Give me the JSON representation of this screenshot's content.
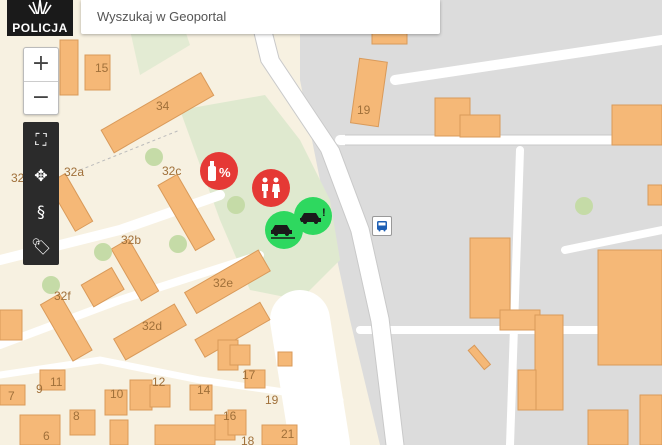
{
  "logo": {
    "text": "POLICJA"
  },
  "search": {
    "placeholder": "Wyszukaj w Geoportal"
  },
  "zoom": {
    "in": "+",
    "out": "−"
  },
  "tools": [
    "⛶",
    "✥",
    "§",
    "🏷"
  ],
  "labels": [
    {
      "t": "15"
    },
    {
      "t": "34"
    },
    {
      "t": "19"
    },
    {
      "t": "32a"
    },
    {
      "t": "32"
    },
    {
      "t": "32c"
    },
    {
      "t": "32b"
    },
    {
      "t": "32f"
    },
    {
      "t": "32e"
    },
    {
      "t": "32d"
    },
    {
      "t": "9"
    },
    {
      "t": "11"
    },
    {
      "t": "12"
    },
    {
      "t": "14"
    },
    {
      "t": "10"
    },
    {
      "t": "17"
    },
    {
      "t": "19"
    },
    {
      "t": "7"
    },
    {
      "t": "8"
    },
    {
      "t": "16"
    },
    {
      "t": "21"
    },
    {
      "t": "6"
    },
    {
      "t": "18"
    }
  ],
  "markers": [
    {
      "name": "alcohol-marker",
      "color": "#e53935"
    },
    {
      "name": "family-marker",
      "color": "#e53935"
    },
    {
      "name": "parking-alert-marker",
      "color": "#2ed85f"
    },
    {
      "name": "parking-marker",
      "color": "#2ed85f"
    }
  ]
}
